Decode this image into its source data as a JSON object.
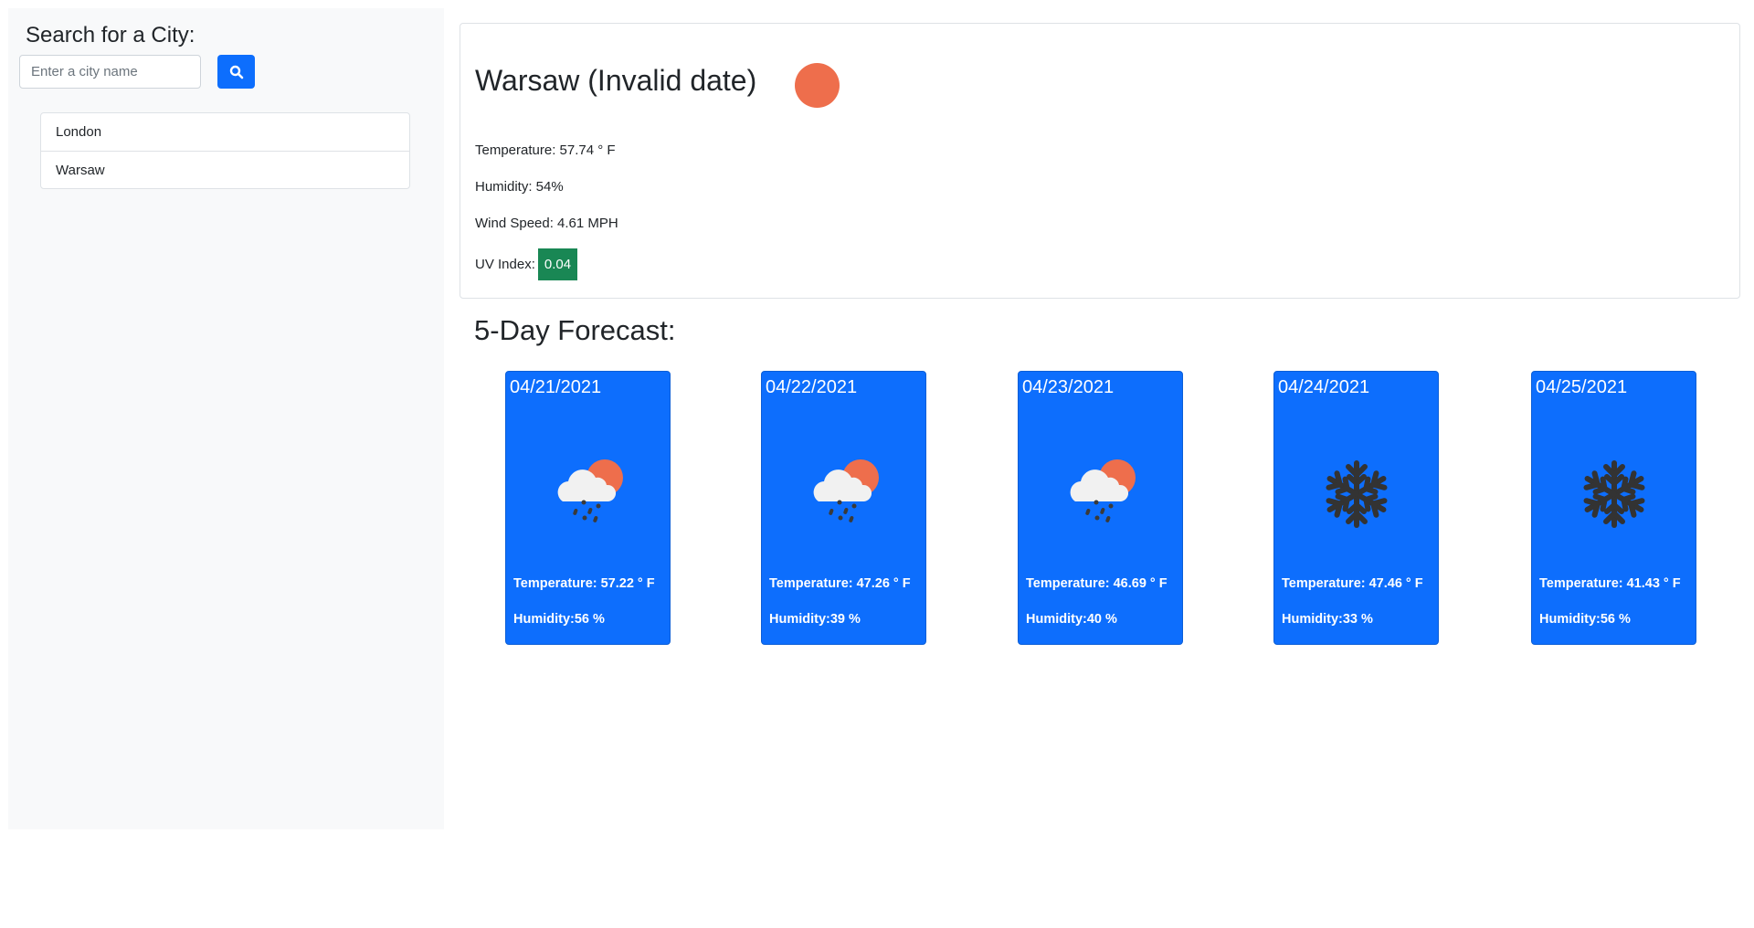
{
  "sidebar": {
    "title": "Search for a City:",
    "search_placeholder": "Enter a city name",
    "search_value": "",
    "history": [
      "London",
      "Warsaw"
    ]
  },
  "current": {
    "heading": "Warsaw (Invalid date)",
    "icon": "sun-icon",
    "temperature": "Temperature: 57.74 ° F",
    "humidity": "Humidity: 54%",
    "wind": "Wind Speed: 4.61 MPH",
    "uv_label": "UV Index:",
    "uv_value": "0.04",
    "uv_color": "#198754"
  },
  "forecast": {
    "title": "5-Day Forecast:",
    "days": [
      {
        "date": "04/21/2021",
        "icon": "rain-sun",
        "temp": "Temperature: 57.22 ° F",
        "hum": "Humidity:56 %"
      },
      {
        "date": "04/22/2021",
        "icon": "rain-sun",
        "temp": "Temperature: 47.26 ° F",
        "hum": "Humidity:39 %"
      },
      {
        "date": "04/23/2021",
        "icon": "rain-sun",
        "temp": "Temperature: 46.69 ° F",
        "hum": "Humidity:40 %"
      },
      {
        "date": "04/24/2021",
        "icon": "snow",
        "temp": "Temperature: 47.46 ° F",
        "hum": "Humidity:33 %"
      },
      {
        "date": "04/25/2021",
        "icon": "snow",
        "temp": "Temperature: 41.43 ° F",
        "hum": "Humidity:56 %"
      }
    ]
  },
  "colors": {
    "accent": "#0d6efd",
    "sun": "#ee6e4c"
  }
}
